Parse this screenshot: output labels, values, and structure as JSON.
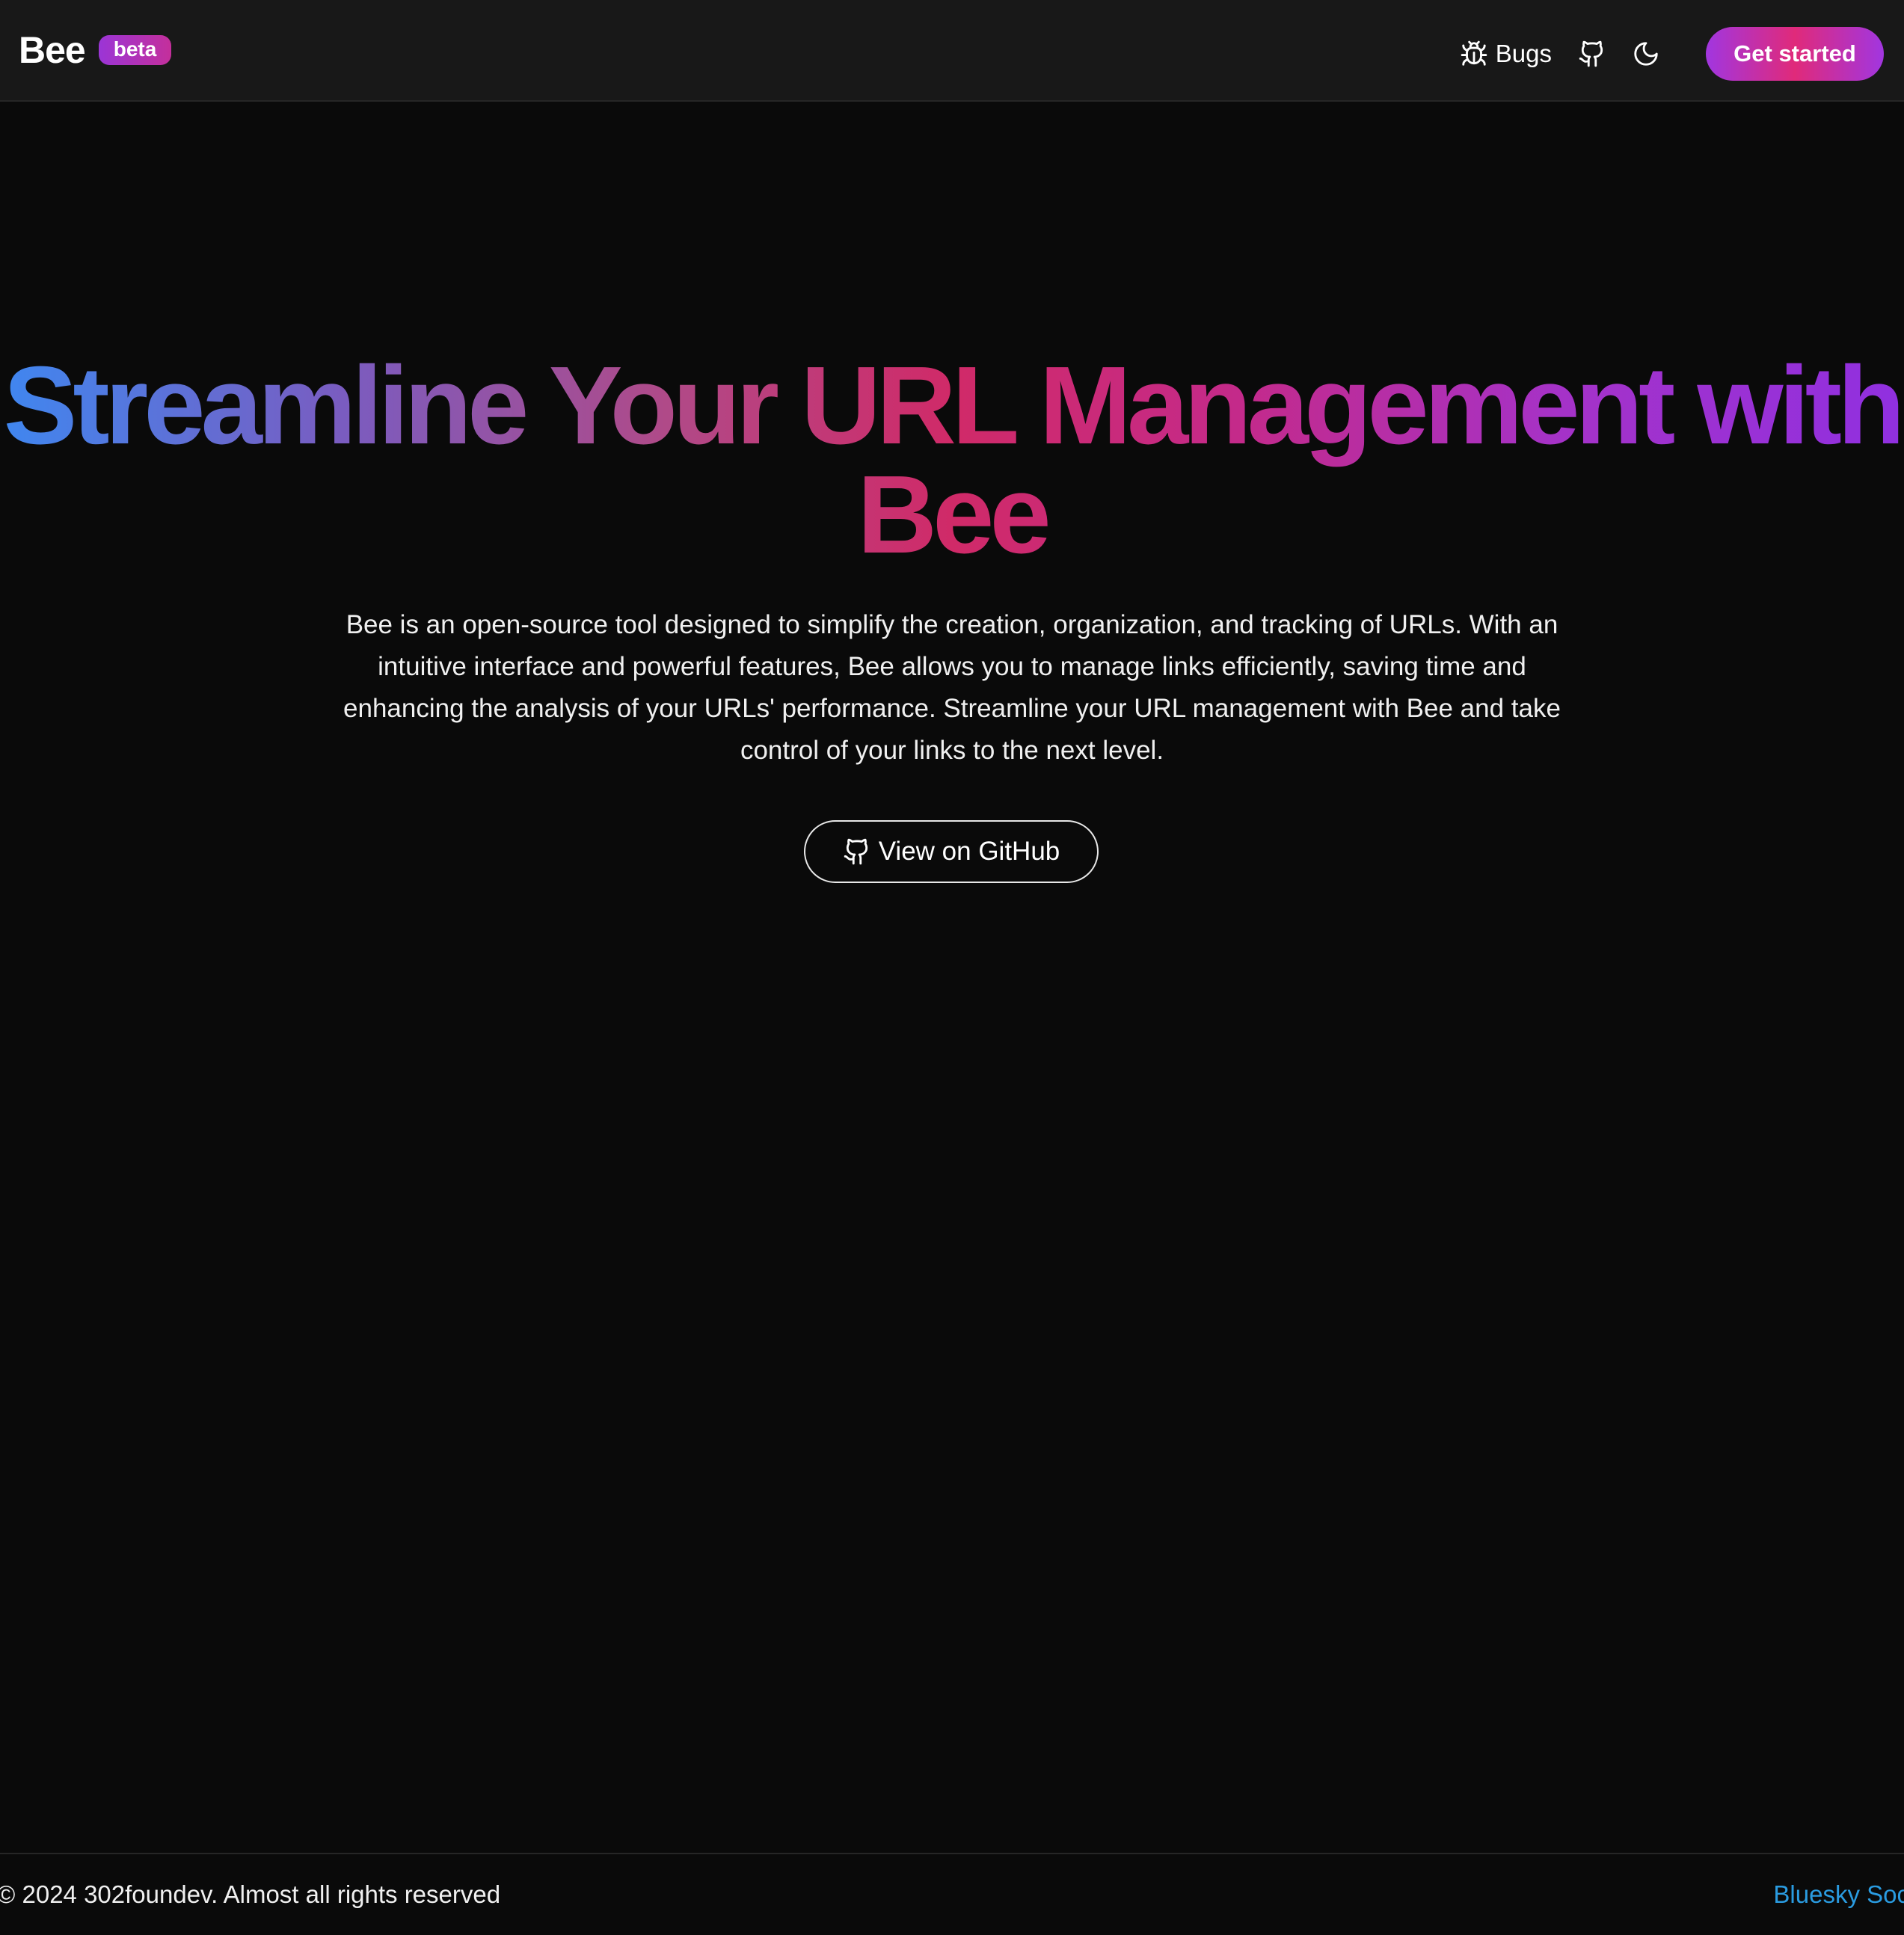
{
  "header": {
    "brand": "Bee",
    "badge": "beta",
    "bugs_label": "Bugs",
    "cta_label": "Get started",
    "icons": [
      "bug-icon",
      "github-icon",
      "moon-icon"
    ]
  },
  "hero": {
    "title": "Streamline Your URL Management with Bee",
    "description": "Bee is an open-source tool designed to simplify the creation, organization, and tracking of URLs. With an intuitive interface and powerful features, Bee allows you to manage links efficiently, saving time and enhancing the analysis of your URLs' performance. Streamline your URL management with Bee and take control of your links to the next level.",
    "github_button_label": "View on GitHub"
  },
  "footer": {
    "copyright": "© 2024 302foundev. Almost all rights reserved",
    "social_link": "Bluesky Social"
  },
  "colors": {
    "background": "#0a0a0a",
    "header_background": "#181818",
    "gradient_blue": "#3f87f0",
    "gradient_pink": "#d02a68",
    "gradient_purple": "#9030e0",
    "link_blue": "#2a9be0"
  }
}
